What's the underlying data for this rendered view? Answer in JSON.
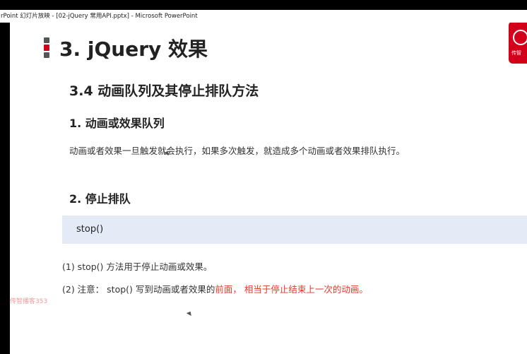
{
  "window": {
    "title": "rPoint 幻灯片放映 - [02-jQuery 常用API.pptx] - Microsoft PowerPoint"
  },
  "watermark": "传智播客353",
  "slide": {
    "main_title": "3. jQuery 效果",
    "sub_title": "3.4  动画队列及其停止排队方法",
    "section1_heading": "1. 动画或效果队列",
    "section1_text": "动画或者效果一旦触发就会执行，如果多次触发，就造成多个动画或者效果排队执行。",
    "section2_heading": "2. 停止排队",
    "code": "stop()",
    "note1": "(1) stop() 方法用于停止动画或效果。",
    "note2_prefix": "(2) 注意： stop() 写到动画或者效果的",
    "note2_highlight": "前面， 相当于停止结束上一次的动画。"
  },
  "logo": {
    "label": "传智"
  },
  "colors": {
    "accent_red": "#d3001b",
    "highlight_red": "#e03a2a",
    "code_bg": "#e4ebf7"
  }
}
